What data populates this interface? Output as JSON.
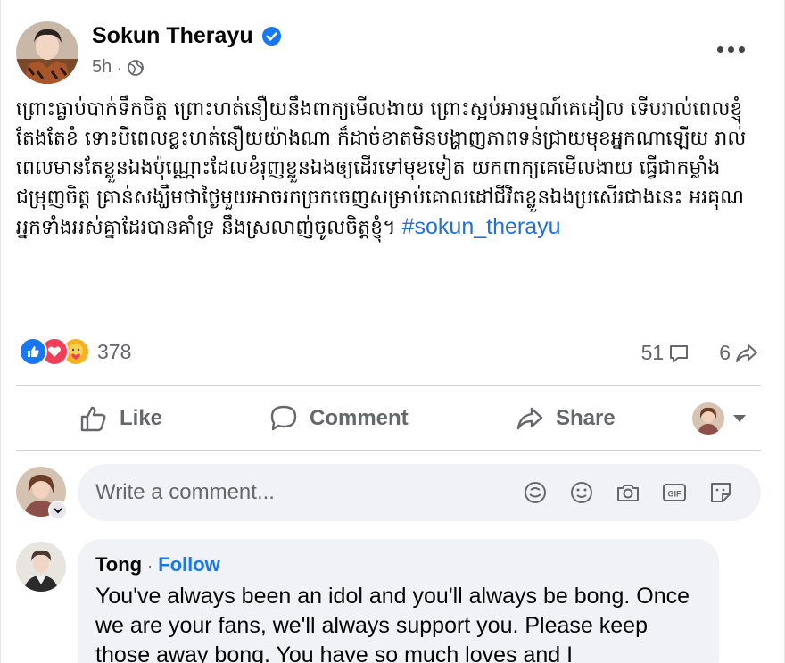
{
  "post": {
    "author": "Sokun Therayu",
    "time": "5h",
    "text": "ព្រោះធ្លាប់បាក់ទឹកចិត្ត ព្រោះហត់នឿយនឹងពាក្យមើលងាយ ព្រោះស្អប់អារម្មណ៍គេដៀល ទើបរាល់ពេលខ្ញុំតែងតែខំ ទោះបីពេលខ្លះហត់នឿយយ៉ាងណា ក៏ដាច់ខាតមិនបង្ហាញភាពទន់ជ្រាយមុខអ្នកណាឡើយ រាល់ពេលមានតែខ្លួនឯងប៉ុណ្ណោះដែលខំរុញខ្លួនឯងឲ្យដើរទៅមុខទៀត យកពាក្យគេមើលងាយ ធ្វើជាកម្លាំងជម្រុញចិត្ត គ្រាន់សង្ឃឹមថាថ្ងៃមួយអាចរកច្រកចេញសម្រាប់គោលដៅជីវិតខ្លួនឯងប្រសើរជាងនេះ អរគុណអ្នកទាំងអស់គ្នាដែរបានគាំទ្រ នឹងស្រលាញ់ចូលចិត្តខ្ញុំ។ ",
    "hashtag": "#sokun_therayu",
    "reaction_count": "378",
    "comment_count": "51",
    "share_count": "6"
  },
  "actions": {
    "like": "Like",
    "comment": "Comment",
    "share": "Share"
  },
  "composer": {
    "placeholder": "Write a comment..."
  },
  "comments": [
    {
      "name": "Tong",
      "follow": "Follow",
      "text": "You've always been an idol and you'll always be bong. Once we are your fans, we'll always support you. Please keep those away bong. You have so much loves and I"
    }
  ],
  "colors": {
    "accent": "#1877f2",
    "secondary_text": "#65676b",
    "bubble": "#f0f2f5"
  }
}
